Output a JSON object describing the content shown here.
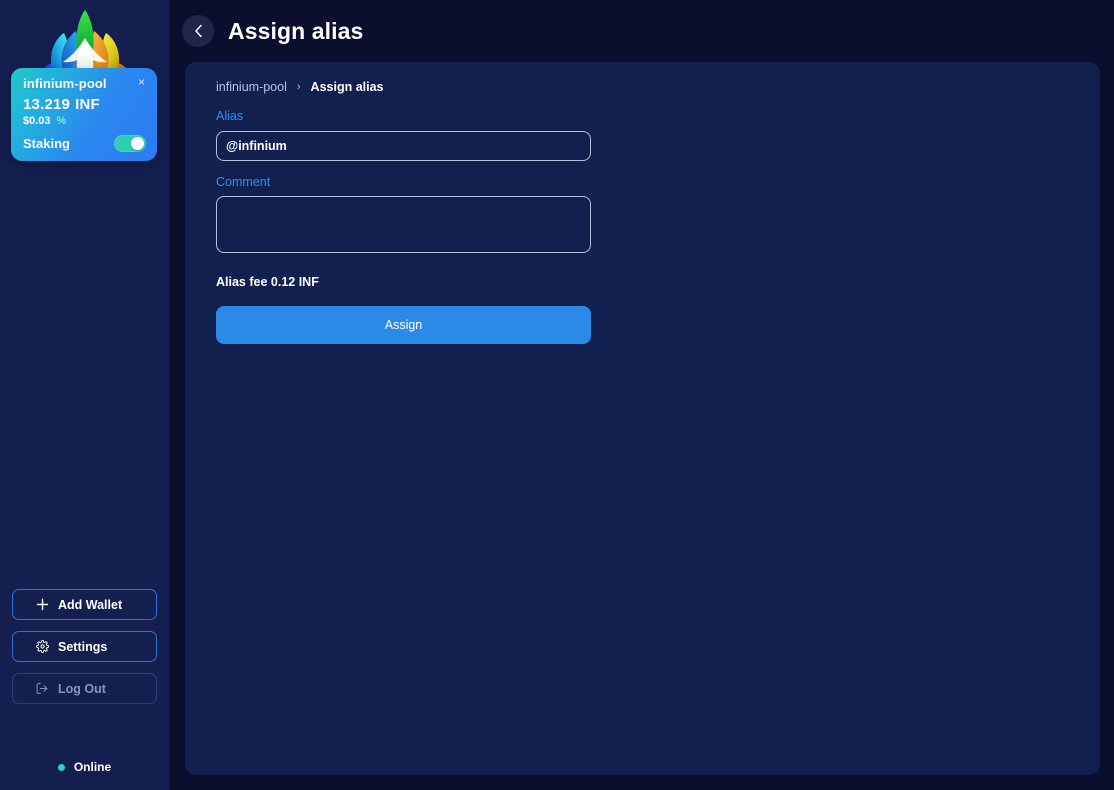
{
  "app": {
    "logo_icon": "infinium-leaf-logo",
    "background_color": "#0b0f2e",
    "sidebar_color": "#141f4f",
    "panel_color": "#12204f",
    "accent_color": "#2b8ae8",
    "label_color": "#2f8ff0"
  },
  "sidebar": {
    "wallet_card": {
      "name": "infinium-pool",
      "close_icon": "×",
      "amount": "13.219",
      "currency": "INF",
      "fiat_value": "$0.03",
      "change_symbol": "%",
      "staking_label": "Staking",
      "staking_on": true,
      "gradient_from": "#1fc9c8",
      "gradient_to": "#2d7bf4",
      "toggle_color": "#2ecfae"
    },
    "buttons": [
      {
        "label": "Add Wallet",
        "icon": "plus-icon",
        "muted": false
      },
      {
        "label": "Settings",
        "icon": "gear-icon",
        "muted": false
      },
      {
        "label": "Log Out",
        "icon": "logout-icon",
        "muted": true
      }
    ],
    "status": {
      "label": "Online",
      "dot_color": "#29d3d3"
    }
  },
  "header": {
    "back_icon": "chevron-left-icon",
    "title": "Assign alias"
  },
  "content": {
    "breadcrumb": {
      "parent": "infinium-pool",
      "separator": "›",
      "current": "Assign alias"
    },
    "alias_field": {
      "label": "Alias",
      "value": "@infinium",
      "placeholder": ""
    },
    "comment_field": {
      "label": "Comment",
      "value": "",
      "placeholder": ""
    },
    "fee_text": "Alias fee 0.12 INF",
    "submit_label": "Assign"
  }
}
